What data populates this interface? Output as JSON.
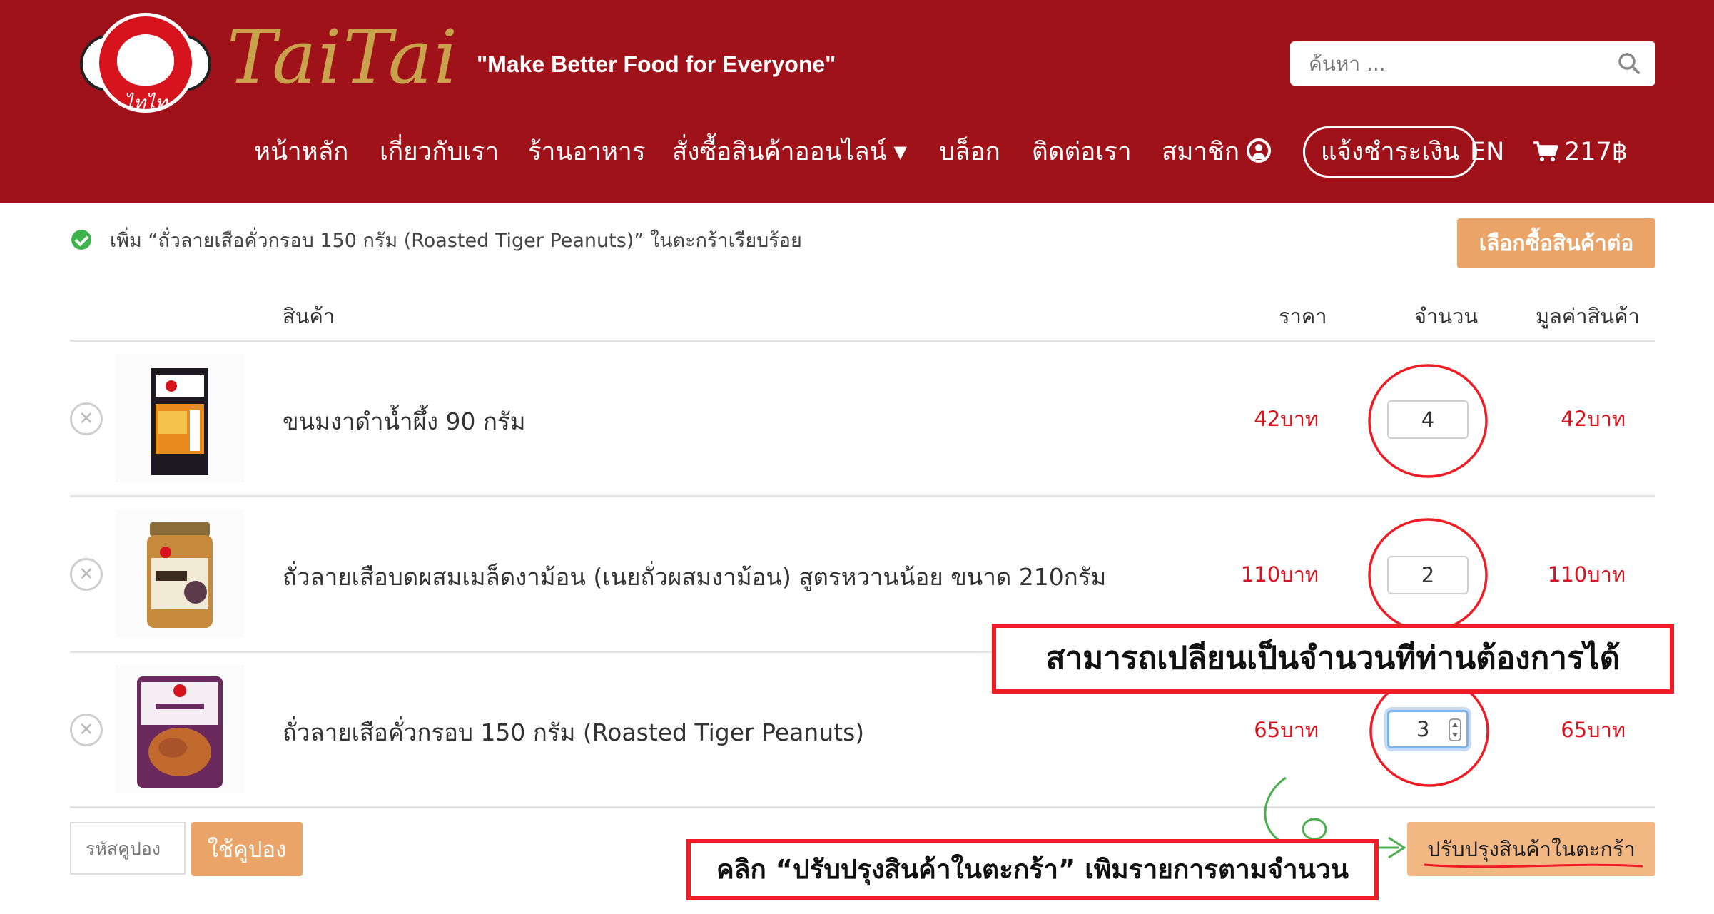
{
  "brand": {
    "logo_text": "ไทไท",
    "wordmark": "TaiTai",
    "tagline": "\"Make Better Food for Everyone\""
  },
  "search": {
    "placeholder": "ค้นหา ..."
  },
  "nav": {
    "home": "หน้าหลัก",
    "about": "เกี่ยวกับเรา",
    "restaurant": "ร้านอาหาร",
    "shop_online": "สั่งซื้อสินค้าออนไลน์",
    "blog": "บล็อก",
    "contact": "ติดต่อเรา",
    "member": "สมาชิก",
    "payment_notice": "แจ้งชำระเงิน",
    "language": "EN",
    "cart_total": "217฿"
  },
  "notice": {
    "message": "เพิ่ม “ถั่วลายเสือคั่วกรอบ 150 กรัม (Roasted Tiger Peanuts)” ในตะกร้าเรียบร้อย",
    "continue_label": "เลือกซื้อสินค้าต่อ"
  },
  "cart_table": {
    "headers": {
      "product": "สินค้า",
      "price": "ราคา",
      "quantity": "จำนวน",
      "subtotal": "มูลค่าสินค้า"
    },
    "rows": [
      {
        "name": "ขนมงาดำน้ำผึ้ง 90 กรัม",
        "price": "42บาท",
        "quantity": "4",
        "subtotal": "42บาท",
        "image_icon": "honey-sesame-package"
      },
      {
        "name": "ถั่วลายเสือบดผสมเมล็ดงาม้อน (เนยถั่วผสมงาม้อน) สูตรหวานน้อย ขนาด 210กรัม",
        "price": "110บาท",
        "quantity": "2",
        "subtotal": "110บาท",
        "image_icon": "peanut-perilla-jar"
      },
      {
        "name": "ถั่วลายเสือคั่วกรอบ 150 กรัม (Roasted Tiger Peanuts)",
        "price": "65บาท",
        "quantity": "3",
        "subtotal": "65บาท",
        "image_icon": "roasted-peanuts-bag"
      }
    ]
  },
  "coupon": {
    "placeholder": "รหัสคูปอง",
    "apply_label": "ใช้คูปอง"
  },
  "update_cart_label": "ปรับปรุงสินค้าในตะกร้า",
  "annotations": {
    "change_quantity": "สามารถเปลียนเป็นจำนวนทีท่านต้องการได้",
    "click_update": "คลิก “ปรับปรุงสินค้าในตะกร้า” เพิมรายการตามจำนวน"
  },
  "colors": {
    "header_bg": "#a01219",
    "accent_button": "#eba468",
    "price_red": "#d7141d",
    "annotation_red": "#ee1c24",
    "annotation_green": "#4caf50",
    "gold": "#c9a24c"
  }
}
